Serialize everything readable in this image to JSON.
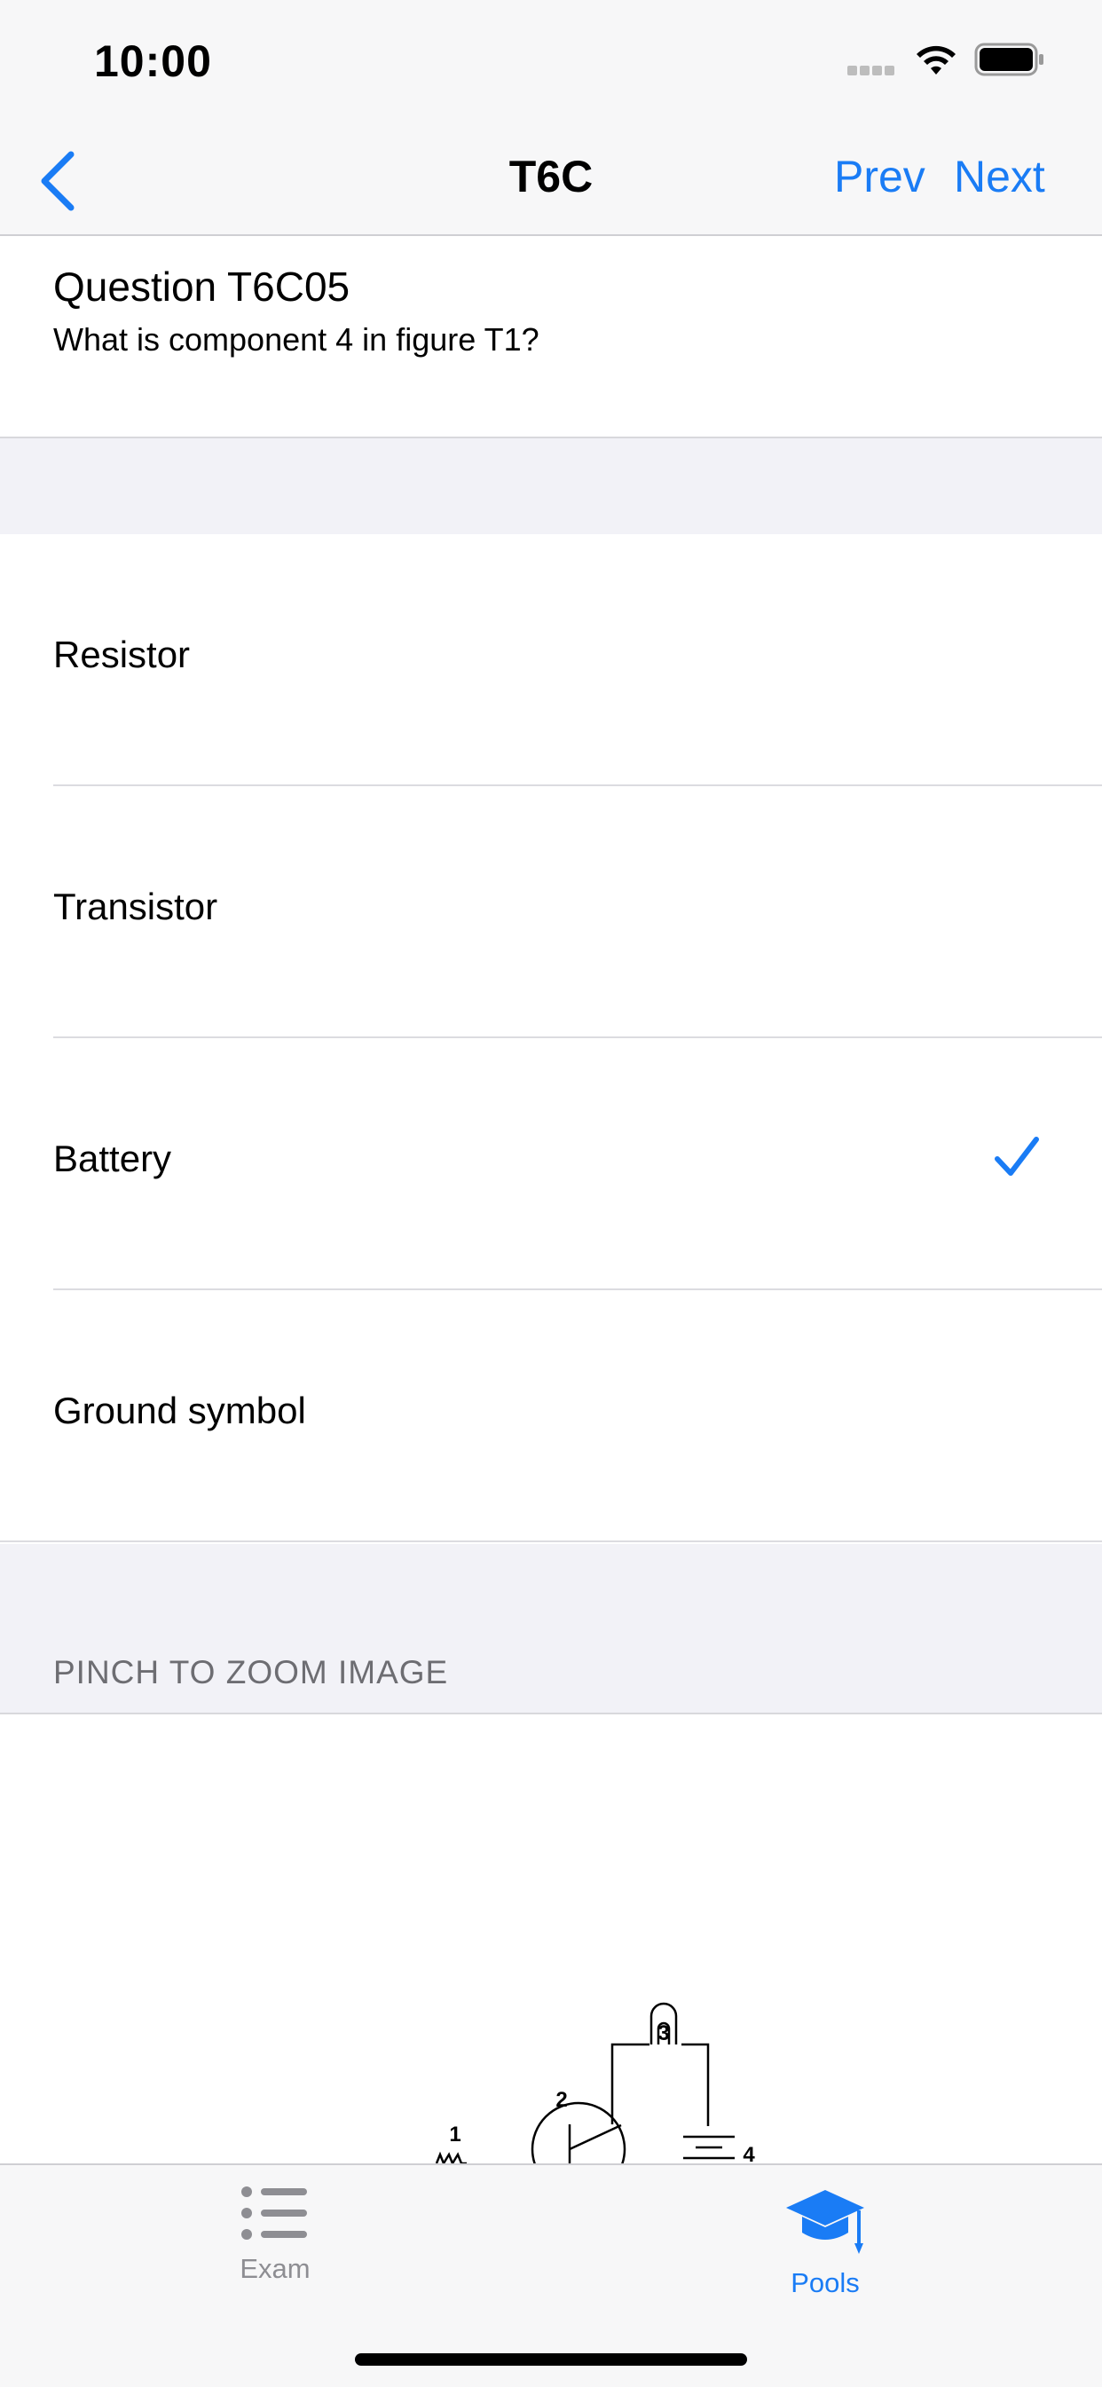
{
  "status_bar": {
    "time": "10:00"
  },
  "nav": {
    "title": "T6C",
    "prev_label": "Prev",
    "next_label": "Next"
  },
  "question": {
    "heading": "Question T6C05",
    "text": "What is component 4 in figure T1?"
  },
  "answers": [
    {
      "label": "Resistor",
      "selected": false
    },
    {
      "label": "Transistor",
      "selected": false
    },
    {
      "label": "Battery",
      "selected": true
    },
    {
      "label": "Ground symbol",
      "selected": false
    }
  ],
  "image_section": {
    "header": "PINCH TO ZOOM IMAGE",
    "figure_labels": [
      "1",
      "2",
      "3",
      "4"
    ]
  },
  "tabs": [
    {
      "label": "Exam",
      "icon": "list-icon",
      "active": false
    },
    {
      "label": "Pools",
      "icon": "graduation-cap-icon",
      "active": true
    }
  ],
  "colors": {
    "accent": "#1a7cf5",
    "inactive": "#8e8e93",
    "background": "#f2f2f7"
  }
}
